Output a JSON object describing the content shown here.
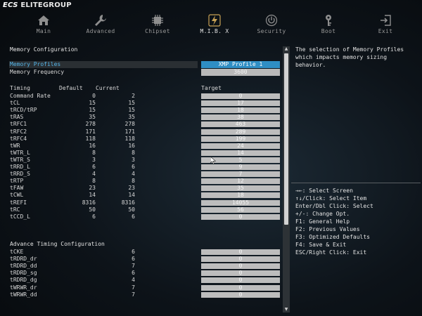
{
  "brand": {
    "mark": "ECS",
    "name": "ELITEGROUP"
  },
  "nav": [
    {
      "label": "Main",
      "icon": "home-icon",
      "active": false
    },
    {
      "label": "Advanced",
      "icon": "wrench-icon",
      "active": false
    },
    {
      "label": "Chipset",
      "icon": "chip-icon",
      "active": false
    },
    {
      "label": "M.I.B. X",
      "icon": "lightning-icon",
      "active": true
    },
    {
      "label": "Security",
      "icon": "power-icon",
      "active": false
    },
    {
      "label": "Boot",
      "icon": "key-icon",
      "active": false
    },
    {
      "label": "Exit",
      "icon": "exit-icon",
      "active": false
    }
  ],
  "memory": {
    "title": "Memory Configuration",
    "profiles_label": "Memory Profiles",
    "profiles_value": "XMP Profile 1",
    "frequency_label": "Memory Frequency",
    "frequency_value": "3600"
  },
  "timing_headers": {
    "timing": "Timing",
    "default": "Default",
    "current": "Current",
    "target": "Target"
  },
  "timings": [
    {
      "name": "Command Rate",
      "default": "0",
      "current": "2",
      "target": "0"
    },
    {
      "name": "tCL",
      "default": "15",
      "current": "15",
      "target": "17"
    },
    {
      "name": "tRCD/tRP",
      "default": "15",
      "current": "15",
      "target": "18"
    },
    {
      "name": "tRAS",
      "default": "35",
      "current": "35",
      "target": "38"
    },
    {
      "name": "tRFC1",
      "default": "278",
      "current": "278",
      "target": "463"
    },
    {
      "name": "tRFC2",
      "default": "171",
      "current": "171",
      "target": "289"
    },
    {
      "name": "tRFC4",
      "default": "118",
      "current": "118",
      "target": "199"
    },
    {
      "name": "tWR",
      "default": "16",
      "current": "16",
      "target": "24"
    },
    {
      "name": "tWTR_L",
      "default": "8",
      "current": "8",
      "target": "14"
    },
    {
      "name": "tWTR_S",
      "default": "3",
      "current": "3",
      "target": "5"
    },
    {
      "name": "tRRD_L",
      "default": "6",
      "current": "6",
      "target": "9"
    },
    {
      "name": "tRRD_S",
      "default": "4",
      "current": "4",
      "target": "7"
    },
    {
      "name": "tRTP",
      "default": "8",
      "current": "8",
      "target": "12"
    },
    {
      "name": "tFAW",
      "default": "23",
      "current": "23",
      "target": "35"
    },
    {
      "name": "tCWL",
      "default": "14",
      "current": "14",
      "target": "18"
    },
    {
      "name": "tREFI",
      "default": "8316",
      "current": "8316",
      "target": "14055"
    },
    {
      "name": "tRC",
      "default": "50",
      "current": "50",
      "target": "56"
    },
    {
      "name": "tCCD_L",
      "default": "6",
      "current": "6",
      "target": "0"
    }
  ],
  "advance": {
    "title": "Advance Timing Configuration",
    "rows": [
      {
        "name": "tCKE",
        "current": "6",
        "target": "0"
      },
      {
        "name": "tRDRD_dr",
        "current": "6",
        "target": "0"
      },
      {
        "name": "tRDRD_dd",
        "current": "7",
        "target": "0"
      },
      {
        "name": "tRDRD_sg",
        "current": "6",
        "target": "0"
      },
      {
        "name": "tRDRD_dg",
        "current": "4",
        "target": "0"
      },
      {
        "name": "tWRWR_dr",
        "current": "7",
        "target": "0"
      },
      {
        "name": "tWRWR_dd",
        "current": "7",
        "target": "0"
      }
    ]
  },
  "help_text": "The selection of Memory Profiles which impacts memory sizing behavior.",
  "keys": [
    "→←: Select Screen",
    "↑↓/Click: Select Item",
    "Enter/Dbl Click: Select",
    "+/-: Change Opt.",
    "F1: General Help",
    "F2: Previous Values",
    "F3: Optimized Defaults",
    "F4: Save & Exit",
    "ESC/Right Click: Exit"
  ],
  "colors": {
    "accent_blue": "#2f8ec4",
    "selected_text": "#56b6e9",
    "active_nav": "#c9a255"
  }
}
